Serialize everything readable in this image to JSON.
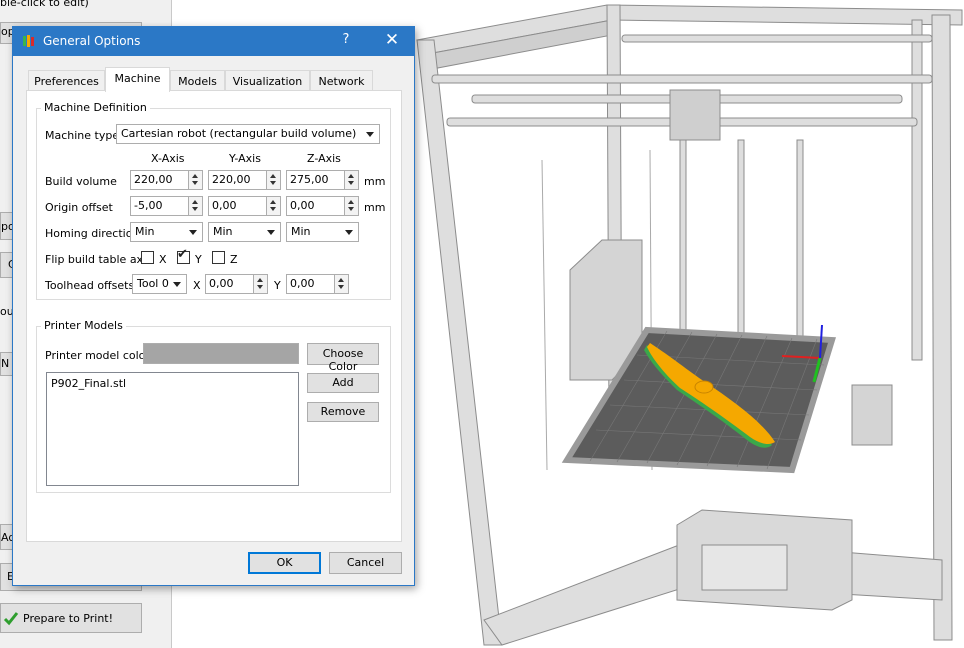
{
  "background_app": {
    "top_hint": "ble-click to edit)",
    "partial_labels": [
      "ope",
      "po",
      "C",
      "ou",
      "N",
      "Add",
      "E"
    ],
    "prepare_label": "Prepare to Print!",
    "prepare_icon": "green-checkmark-icon"
  },
  "dialog": {
    "title": "General Options",
    "help_label": "?",
    "close_label": "✕",
    "icon": "app-logo-icon",
    "tabs": [
      {
        "label": "Preferences",
        "active": false
      },
      {
        "label": "Machine",
        "active": true
      },
      {
        "label": "Models",
        "active": false
      },
      {
        "label": "Visualization",
        "active": false
      },
      {
        "label": "Network",
        "active": false
      }
    ],
    "machine_definition": {
      "group_title": "Machine Definition",
      "machine_type_label": "Machine type",
      "machine_type_value": "Cartesian robot (rectangular build volume)",
      "axis_headers": [
        "X-Axis",
        "Y-Axis",
        "Z-Axis"
      ],
      "build_volume_label": "Build volume",
      "build_volume": [
        "220,00",
        "220,00",
        "275,00"
      ],
      "origin_offset_label": "Origin offset",
      "origin_offset": [
        "-5,00",
        "0,00",
        "0,00"
      ],
      "unit": "mm",
      "homing_direction_label": "Homing direction",
      "homing_direction": [
        "Min",
        "Min",
        "Min"
      ],
      "flip_label": "Flip build table axis",
      "flip_axes": [
        {
          "label": "X",
          "checked": false
        },
        {
          "label": "Y",
          "checked": true
        },
        {
          "label": "Z",
          "checked": false
        }
      ],
      "toolhead_label": "Toolhead offsets",
      "toolhead_tool": "Tool 0",
      "toolhead_x_label": "X",
      "toolhead_x": "0,00",
      "toolhead_y_label": "Y",
      "toolhead_y": "0,00"
    },
    "printer_models": {
      "group_title": "Printer Models",
      "color_label": "Printer model color",
      "color_value": "#a5a5a5",
      "choose_color_label": "Choose Color",
      "models": [
        "P902_Final.stl"
      ],
      "add_label": "Add",
      "remove_label": "Remove"
    },
    "ok_label": "OK",
    "cancel_label": "Cancel",
    "accent_color": "#2b78c6"
  },
  "viewport": {
    "scene": "3d-printer-frame-with-propeller-model",
    "bed_color": "#5c5c5c",
    "model_color": "#f5a800",
    "axis_colors": {
      "x": "#e02020",
      "y": "#20c020",
      "z": "#2020e0"
    }
  }
}
